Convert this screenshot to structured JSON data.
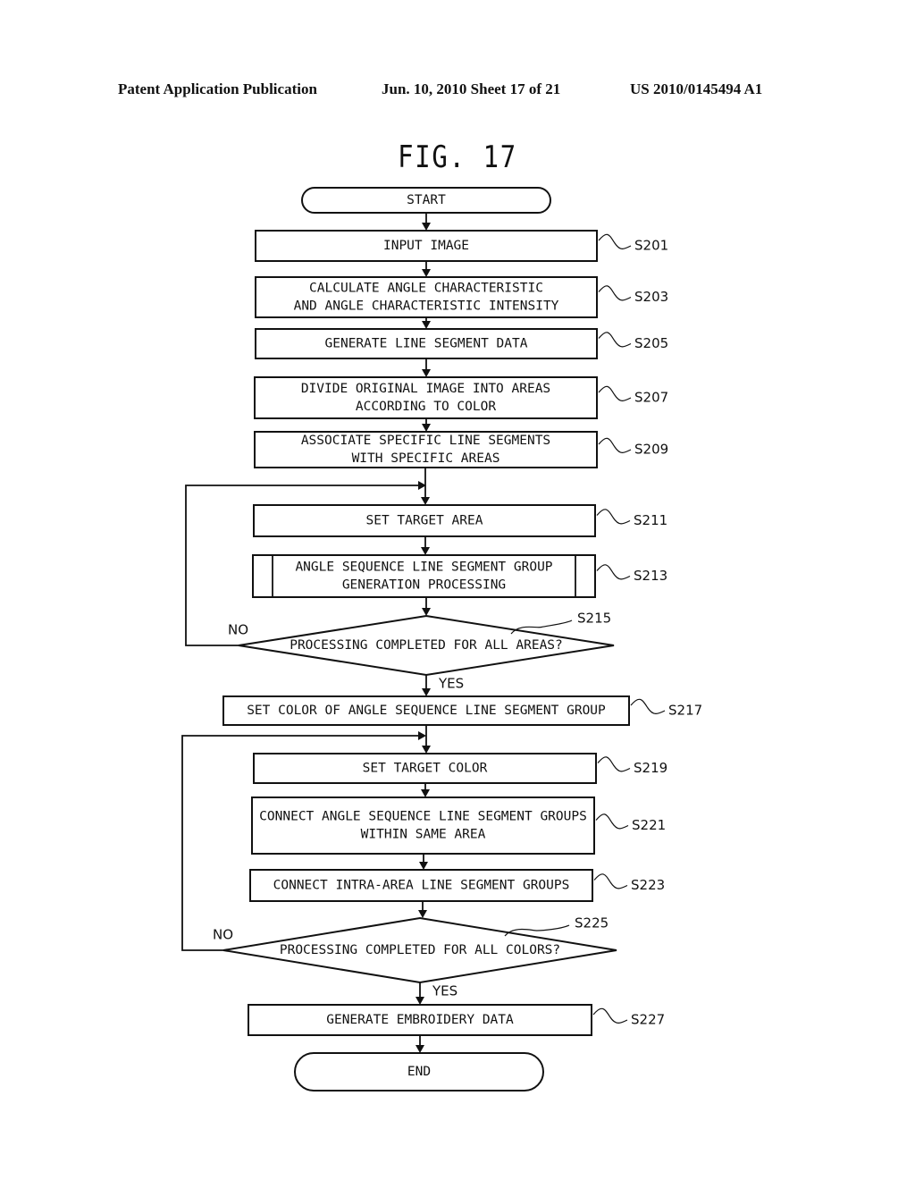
{
  "header": {
    "publication": "Patent Application Publication",
    "date_sheet": "Jun. 10, 2010  Sheet 17 of 21",
    "pub_number": "US 2010/0145494 A1"
  },
  "figure": {
    "title": "FIG. 17"
  },
  "flowchart": {
    "start": "START",
    "end": "END",
    "steps": [
      {
        "id": "S201",
        "lines": [
          "INPUT IMAGE"
        ]
      },
      {
        "id": "S203",
        "lines": [
          "CALCULATE ANGLE CHARACTERISTIC",
          "AND ANGLE CHARACTERISTIC INTENSITY"
        ]
      },
      {
        "id": "S205",
        "lines": [
          "GENERATE LINE SEGMENT DATA"
        ]
      },
      {
        "id": "S207",
        "lines": [
          "DIVIDE ORIGINAL IMAGE INTO AREAS",
          "ACCORDING TO COLOR"
        ]
      },
      {
        "id": "S209",
        "lines": [
          "ASSOCIATE SPECIFIC LINE SEGMENTS",
          "WITH SPECIFIC AREAS"
        ]
      },
      {
        "id": "S211",
        "lines": [
          "SET TARGET AREA"
        ]
      },
      {
        "id": "S213",
        "lines": [
          "ANGLE SEQUENCE LINE SEGMENT GROUP",
          "GENERATION PROCESSING"
        ],
        "type": "subprocess"
      },
      {
        "id": "S215",
        "lines": [
          "PROCESSING COMPLETED FOR ALL AREAS?"
        ],
        "type": "decision",
        "no": "NO",
        "yes": "YES"
      },
      {
        "id": "S217",
        "lines": [
          "SET COLOR OF ANGLE SEQUENCE LINE SEGMENT GROUP"
        ]
      },
      {
        "id": "S219",
        "lines": [
          "SET TARGET COLOR"
        ]
      },
      {
        "id": "S221",
        "lines": [
          "CONNECT ANGLE SEQUENCE LINE SEGMENT GROUPS",
          "WITHIN SAME AREA"
        ]
      },
      {
        "id": "S223",
        "lines": [
          "CONNECT INTRA-AREA LINE SEGMENT GROUPS"
        ]
      },
      {
        "id": "S225",
        "lines": [
          "PROCESSING COMPLETED FOR ALL COLORS?"
        ],
        "type": "decision",
        "no": "NO",
        "yes": "YES"
      },
      {
        "id": "S227",
        "lines": [
          "GENERATE EMBROIDERY DATA"
        ]
      }
    ]
  }
}
